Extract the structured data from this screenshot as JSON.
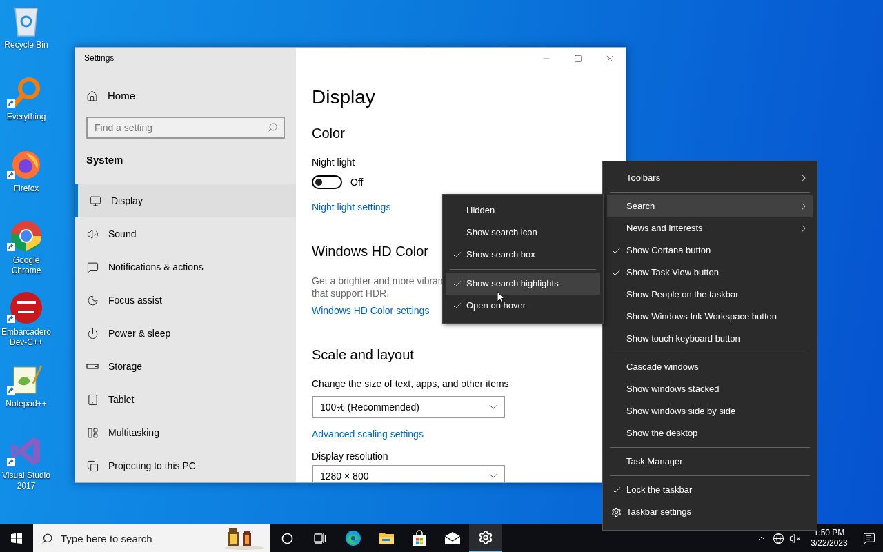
{
  "desktop_icons": [
    {
      "kind": "recycle",
      "label": "Recycle Bin",
      "shortcut": false
    },
    {
      "kind": "everything",
      "label": "Everything",
      "shortcut": true
    },
    {
      "kind": "firefox",
      "label": "Firefox",
      "shortcut": true
    },
    {
      "kind": "chrome",
      "label": "Google Chrome",
      "shortcut": true
    },
    {
      "kind": "devcpp",
      "label": "Embarcadero Dev-C++",
      "shortcut": true
    },
    {
      "kind": "notepad",
      "label": "Notepad++",
      "shortcut": true
    },
    {
      "kind": "vs",
      "label": "Visual Studio 2017",
      "shortcut": true
    }
  ],
  "settings_window": {
    "title": "Settings",
    "home": "Home",
    "search": {
      "placeholder": "Find a setting"
    },
    "category": "System",
    "nav": [
      {
        "label": "Display",
        "selected": true
      },
      {
        "label": "Sound",
        "selected": false
      },
      {
        "label": "Notifications & actions",
        "selected": false
      },
      {
        "label": "Focus assist",
        "selected": false
      },
      {
        "label": "Power & sleep",
        "selected": false
      },
      {
        "label": "Storage",
        "selected": false
      },
      {
        "label": "Tablet",
        "selected": false
      },
      {
        "label": "Multitasking",
        "selected": false
      },
      {
        "label": "Projecting to this PC",
        "selected": false
      }
    ],
    "page_title": "Display",
    "blocks": [
      {
        "kind": "section",
        "text": "Color"
      },
      {
        "kind": "label",
        "text": "Night light"
      },
      {
        "kind": "toggle",
        "on": false,
        "text": "Off"
      },
      {
        "kind": "link",
        "text": "Night light settings"
      },
      {
        "kind": "section",
        "text": "Windows HD Color"
      },
      {
        "kind": "text",
        "lines": [
          "Get a brighter and more vibran",
          "that support HDR."
        ]
      },
      {
        "kind": "link",
        "text": "Windows HD Color settings"
      },
      {
        "kind": "section",
        "text": "Scale and layout"
      },
      {
        "kind": "label",
        "text": "Change the size of text, apps, and other items"
      },
      {
        "kind": "dropdown",
        "text": "100% (Recommended)"
      },
      {
        "kind": "link",
        "text": "Advanced scaling settings"
      },
      {
        "kind": "label",
        "text": "Display resolution"
      },
      {
        "kind": "dropdown",
        "text": "1280 × 800"
      }
    ]
  },
  "context_menu": {
    "groups": [
      [
        {
          "kind": "submenu",
          "label": "Toolbars",
          "checked": false,
          "selected": false
        }
      ],
      [
        {
          "kind": "submenu",
          "label": "Search",
          "checked": false,
          "selected": true
        },
        {
          "kind": "submenu",
          "label": "News and interests",
          "checked": false,
          "selected": false
        },
        {
          "kind": "option",
          "label": "Show Cortana button",
          "checked": true,
          "selected": false
        },
        {
          "kind": "option",
          "label": "Show Task View button",
          "checked": true,
          "selected": false
        },
        {
          "kind": "option",
          "label": "Show People on the taskbar",
          "checked": false,
          "selected": false
        },
        {
          "kind": "option",
          "label": "Show Windows Ink Workspace button",
          "checked": false,
          "selected": false
        },
        {
          "kind": "option",
          "label": "Show touch keyboard button",
          "checked": false,
          "selected": false
        }
      ],
      [
        {
          "kind": "option",
          "label": "Cascade windows",
          "checked": false,
          "selected": false
        },
        {
          "kind": "option",
          "label": "Show windows stacked",
          "checked": false,
          "selected": false
        },
        {
          "kind": "option",
          "label": "Show windows side by side",
          "checked": false,
          "selected": false
        },
        {
          "kind": "option",
          "label": "Show the desktop",
          "checked": false,
          "selected": false
        }
      ],
      [
        {
          "kind": "option",
          "label": "Task Manager",
          "checked": false,
          "selected": false
        }
      ],
      [
        {
          "kind": "option",
          "label": "Lock the taskbar",
          "checked": true,
          "selected": false
        },
        {
          "kind": "settings",
          "label": "Taskbar settings",
          "checked": false,
          "selected": false
        }
      ]
    ]
  },
  "search_submenu": {
    "groups": [
      [
        {
          "label": "Hidden",
          "checked": false,
          "selected": false
        },
        {
          "label": "Show search icon",
          "checked": false,
          "selected": false
        },
        {
          "label": "Show search box",
          "checked": true,
          "selected": false
        }
      ],
      [
        {
          "label": "Show search highlights",
          "checked": true,
          "selected": true
        },
        {
          "label": "Open on hover",
          "checked": true,
          "selected": false
        }
      ]
    ]
  },
  "taskbar": {
    "search": {
      "placeholder": "Type here to search"
    },
    "apps": [
      {
        "kind": "cortana",
        "selected": false
      },
      {
        "kind": "taskview",
        "selected": false
      },
      {
        "kind": "edge",
        "selected": false
      },
      {
        "kind": "explorer",
        "selected": false
      },
      {
        "kind": "store",
        "selected": false
      },
      {
        "kind": "mail",
        "selected": false
      },
      {
        "kind": "settings",
        "selected": true
      }
    ],
    "time": "1:50 PM",
    "date": "3/22/2023"
  }
}
